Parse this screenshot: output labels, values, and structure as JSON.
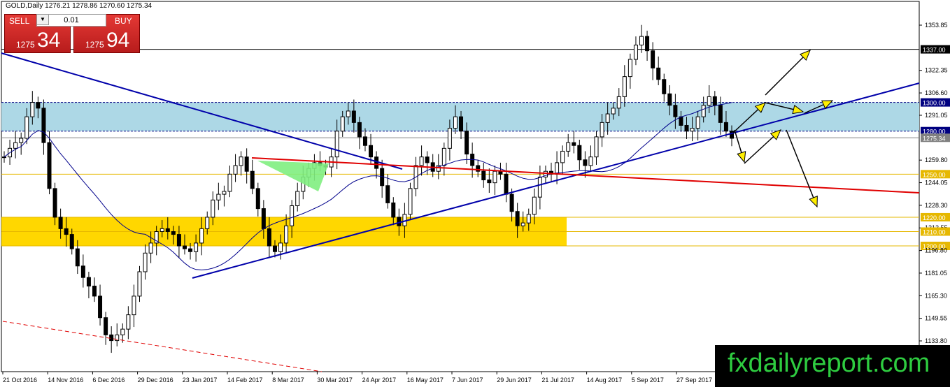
{
  "header": {
    "symbol": "GOLD,Daily",
    "ohlc": "1276.21 1278.86 1270.60 1275.34"
  },
  "trade_panel": {
    "sell_label": "SELL",
    "buy_label": "BUY",
    "lot_value": "0.01",
    "sell_price_small": "1275",
    "sell_price_big": "34",
    "buy_price_small": "1275",
    "buy_price_big": "94"
  },
  "watermark": "fxdailyreport.com",
  "chart_data": {
    "type": "candlestick",
    "price_ticks": [
      "1353.85",
      "1337.00",
      "1322.35",
      "1306.60",
      "1300.00",
      "1291.05",
      "1280.00",
      "1275.34",
      "1259.80",
      "1250.00",
      "1244.05",
      "1228.30",
      "1220.00",
      "1212.55",
      "1210.00",
      "1200.00",
      "1196.80",
      "1181.05",
      "1165.30",
      "1149.55",
      "1133.80"
    ],
    "date_labels": [
      "21 Oct 2016",
      "14 Nov 2016",
      "6 Dec 2016",
      "29 Dec 2016",
      "23 Jan 2017",
      "14 Feb 2017",
      "8 Mar 2017",
      "30 Mar 2017",
      "24 Apr 2017",
      "16 May 2017",
      "7 Jun 2017",
      "29 Jun 2017",
      "21 Jul 2017",
      "14 Aug 2017",
      "5 Sep 2017",
      "27 Sep 2017"
    ],
    "highlighted_levels": [
      {
        "label": "1337.00",
        "price": 1337.0,
        "color": "#000000"
      },
      {
        "label": "1300.00",
        "price": 1300.0,
        "color": "#000080"
      },
      {
        "label": "1280.00",
        "price": 1280.0,
        "color": "#000080"
      },
      {
        "label": "1275.34",
        "price": 1275.34,
        "color": "#808080"
      },
      {
        "label": "1250.00",
        "price": 1250.0,
        "color": "#e6b800"
      },
      {
        "label": "1220.00",
        "price": 1220.0,
        "color": "#e6b800"
      },
      {
        "label": "1210.00",
        "price": 1210.0,
        "color": "#e6b800"
      },
      {
        "label": "1200.00",
        "price": 1200.0,
        "color": "#e6b800"
      }
    ],
    "zones": [
      {
        "name": "resistance zone",
        "from": 1280.0,
        "to": 1300.0,
        "color": "#add8e6"
      },
      {
        "name": "support zone",
        "from": 1200.0,
        "to": 1220.0,
        "color": "#ffd700"
      }
    ],
    "close_series": [
      1262,
      1268,
      1272,
      1275,
      1290,
      1300,
      1296,
      1272,
      1240,
      1220,
      1212,
      1208,
      1198,
      1186,
      1178,
      1172,
      1165,
      1150,
      1138,
      1134,
      1138,
      1142,
      1152,
      1165,
      1182,
      1195,
      1202,
      1210,
      1212,
      1210,
      1208,
      1200,
      1198,
      1196,
      1202,
      1212,
      1220,
      1232,
      1236,
      1238,
      1250,
      1256,
      1262,
      1252,
      1240,
      1226,
      1212,
      1200,
      1196,
      1202,
      1214,
      1228,
      1238,
      1248,
      1254,
      1258,
      1256,
      1255,
      1262,
      1280,
      1290,
      1294,
      1286,
      1276,
      1270,
      1262,
      1254,
      1242,
      1230,
      1220,
      1214,
      1222,
      1240,
      1256,
      1262,
      1258,
      1252,
      1256,
      1268,
      1282,
      1290,
      1280,
      1264,
      1256,
      1252,
      1246,
      1244,
      1252,
      1250,
      1236,
      1224,
      1214,
      1216,
      1222,
      1234,
      1248,
      1252,
      1250,
      1258,
      1266,
      1272,
      1270,
      1260,
      1256,
      1262,
      1276,
      1286,
      1292,
      1296,
      1304,
      1318,
      1330,
      1340,
      1346,
      1336,
      1324,
      1316,
      1306,
      1298,
      1290,
      1284,
      1280,
      1282,
      1290,
      1298,
      1304,
      1298,
      1286,
      1280,
      1275
    ]
  }
}
